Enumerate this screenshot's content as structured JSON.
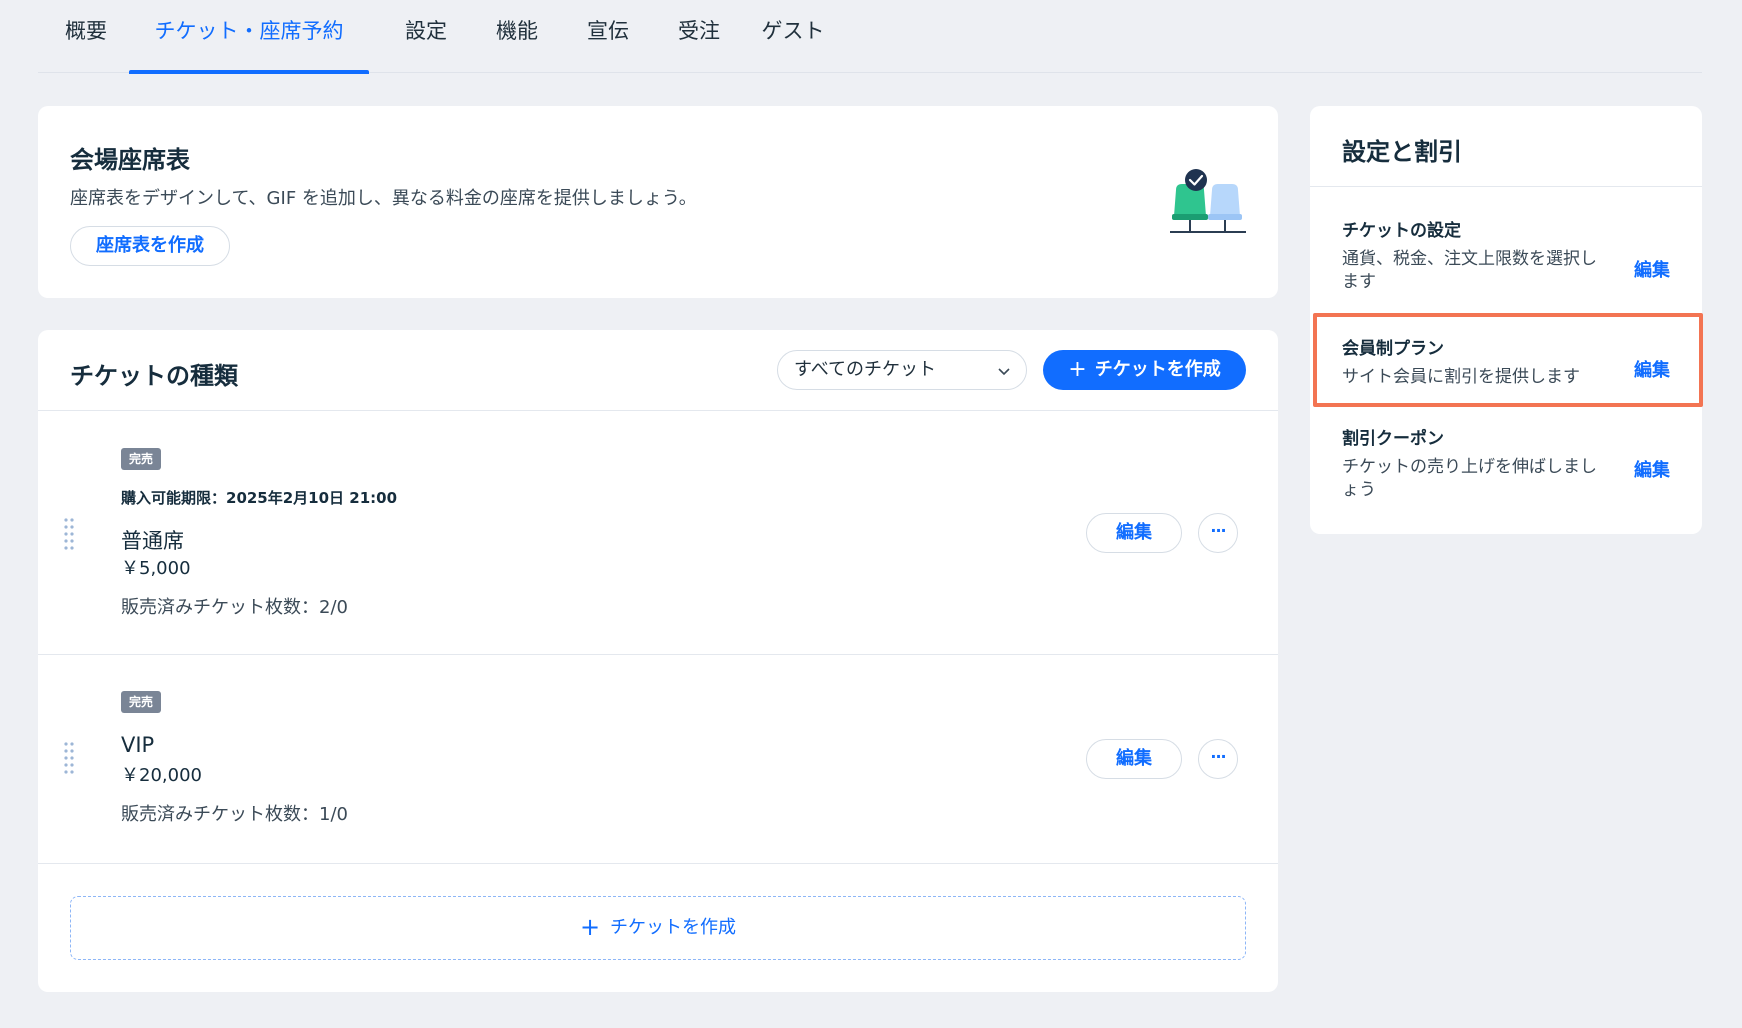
{
  "tabs": [
    {
      "label": "概要"
    },
    {
      "label": "チケット・座席予約"
    },
    {
      "label": "設定"
    },
    {
      "label": "機能"
    },
    {
      "label": "宣伝"
    },
    {
      "label": "受注"
    },
    {
      "label": "ゲスト"
    }
  ],
  "active_tab": "チケット・座席予約",
  "seating": {
    "title": "会場座席表",
    "description": "座席表をデザインして、GIF を追加し、異なる料金の座席を提供しましょう。",
    "create_button": "座席表を作成"
  },
  "tickets": {
    "title": "チケットの種類",
    "filter_value": "すべてのチケット",
    "create_button": "チケットを作成",
    "items": [
      {
        "badge": "完売",
        "deadline": "購入可能期限：2025年2月10日 21:00",
        "name": "普通席",
        "price": "￥5,000",
        "sold": "販売済みチケット枚数：2/0",
        "edit": "編集",
        "more": "···"
      },
      {
        "badge": "完売",
        "name": "VIP",
        "price": "￥20,000",
        "sold": "販売済みチケット枚数：1/0",
        "edit": "編集",
        "more": "···"
      }
    ],
    "add_button": "チケットを作成"
  },
  "settings_panel": {
    "title": "設定と割引",
    "items": [
      {
        "title": "チケットの設定",
        "description": "通貨、税金、注文上限数を選択します",
        "edit": "編集"
      },
      {
        "title": "会員制プラン",
        "description": "サイト会員に割引を提供します",
        "edit": "編集",
        "highlighted": true
      },
      {
        "title": "割引クーポン",
        "description": "チケットの売り上げを伸ばしましょう",
        "edit": "編集"
      }
    ]
  },
  "colors": {
    "accent": "#116dff",
    "highlight": "#f37452",
    "badge": "#7a8596",
    "seat_green": "#2fc58f",
    "seat_light": "#b7d7fb"
  },
  "icons": [
    "seat-map-illustration",
    "check-icon",
    "chevron-down-icon",
    "plus-icon",
    "drag-handle-icon",
    "more-icon"
  ]
}
